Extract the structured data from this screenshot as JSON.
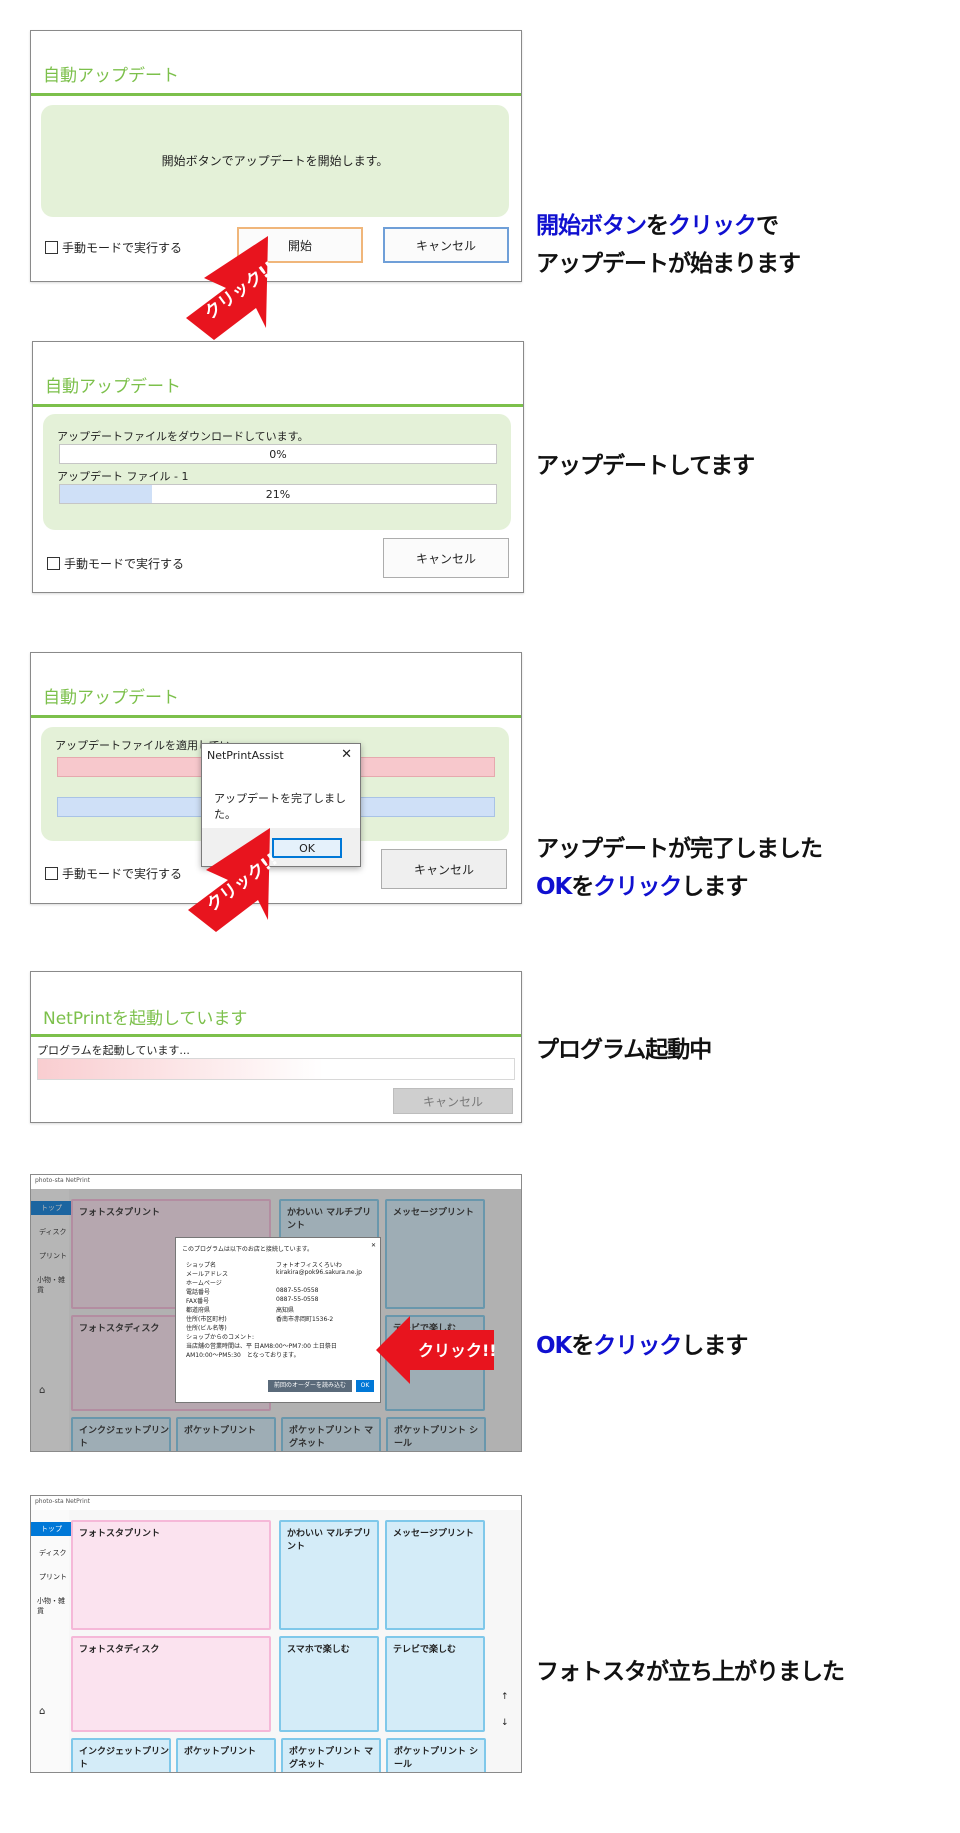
{
  "section1": {
    "title": "自動アップデート",
    "message": "開始ボタンでアップデートを開始します。",
    "checkbox_label": "手動モードで実行する",
    "start_label": "開始",
    "cancel_label": "キャンセル",
    "caption_part1": "開始ボタン",
    "caption_part2": "を",
    "caption_part3": "クリック",
    "caption_part4": "で",
    "caption_line2": "アップデートが始まります"
  },
  "section2": {
    "title": "自動アップデート",
    "download_label": "アップデートファイルをダウンロードしています。",
    "download_percent": "0%",
    "download_progress": 0,
    "file_label": "アップデート ファイル - 1",
    "file_percent": "21%",
    "file_progress": 0.21,
    "checkbox_label": "手動モードで実行する",
    "cancel_label": "キャンセル",
    "caption": "アップデートしてます"
  },
  "section3": {
    "title": "自動アップデート",
    "applying_label": "アップデートファイルを適用してい",
    "dialog_title": "NetPrintAssist",
    "dialog_close": "✕",
    "dialog_message": "アップデートを完了しました。",
    "ok_label": "OK",
    "checkbox_label": "手動モードで実行する",
    "cancel_label": "キャンセル",
    "caption_line1": "アップデートが完了しました",
    "caption_ok": "OK",
    "caption_wo": "を",
    "caption_click": "クリック",
    "caption_end": "します"
  },
  "section4": {
    "title": "NetPrintを起動しています",
    "status": "プログラムを起動しています...",
    "cancel_label": "キャンセル",
    "caption": "プログラム起動中"
  },
  "section5": {
    "app_title": "photo-sta NetPrint",
    "nav": [
      "トップ",
      "ディスク",
      "プリント",
      "小物・雑貨"
    ],
    "tiles": [
      "フォトスタプリント",
      "かわいい マルチプリント",
      "メッセージプリント",
      "フォトスタディスク",
      "テレビで楽しむ",
      "インクジェットプリント",
      "ポケットプリント",
      "ポケットプリント マグネット",
      "ポケットプリント シール"
    ],
    "dialog_header": "このプログラムは以下のお店と接続しています。",
    "shop_rows": [
      [
        "ショップ名",
        "フォトオフィスくろいわ"
      ],
      [
        "メールアドレス",
        "kirakira@pok96.sakura.ne.jp"
      ],
      [
        "ホームページ",
        ""
      ],
      [
        "電話番号",
        "0887-55-0558"
      ],
      [
        "FAX番号",
        "0887-55-0558"
      ],
      [
        "都道府県",
        "高知県"
      ],
      [
        "住所(市区町村)",
        "香南市赤岡町1536-2"
      ],
      [
        "住所(ビル名等)",
        ""
      ],
      [
        "ショップからのコメント:",
        ""
      ]
    ],
    "comment1": "当店舗の営業時間は、平 日AM8:00～PM7:00 土日祭日",
    "comment2": "AM10:00～PM5:30　となっております。",
    "reload_label": "前回のオーダーを読み込む",
    "ok_label": "OK",
    "caption_ok": "OK",
    "caption_wo": "を",
    "caption_click": "クリック",
    "caption_end": "します"
  },
  "section6": {
    "app_title": "photo-sta NetPrint",
    "nav": [
      "トップ",
      "ディスク",
      "プリント",
      "小物・雑貨"
    ],
    "tiles": [
      "フォトスタプリント",
      "かわいい マルチプリント",
      "メッセージプリント",
      "フォトスタディスク",
      "スマホで楽しむ",
      "テレビで楽しむ",
      "インクジェットプリント",
      "ポケットプリント",
      "ポケットプリント マグネット",
      "ポケットプリント シール"
    ],
    "caption": "フォトスタが立ち上がりました"
  },
  "click_badge": "クリック!!",
  "colors": {
    "green": "#7cc04b",
    "blue_text": "#1010d0",
    "arrow_red": "#e8141e",
    "windows_blue": "#0078d7"
  }
}
